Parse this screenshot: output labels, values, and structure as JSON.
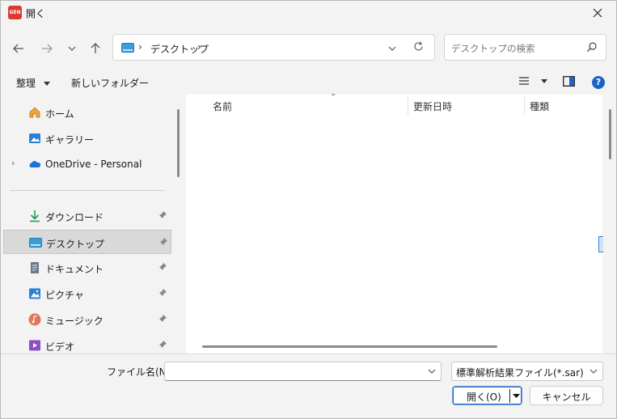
{
  "window": {
    "title": "開く",
    "app_icon_text": "GEN"
  },
  "nav": {
    "address_segments": [
      "デスクトップ"
    ],
    "search_placeholder": "デスクトップの検索"
  },
  "toolbar": {
    "organize_label": "整理",
    "new_folder_label": "新しいフォルダー",
    "help_label": "?"
  },
  "sidebar": {
    "items": [
      {
        "label": "ホーム",
        "icon": "home-icon"
      },
      {
        "label": "ギャラリー",
        "icon": "gallery-icon"
      },
      {
        "label": "OneDrive - Personal",
        "icon": "onedrive-icon"
      },
      {
        "label": "ダウンロード",
        "icon": "download-icon",
        "pinned": true
      },
      {
        "label": "デスクトップ",
        "icon": "desktop-icon",
        "pinned": true,
        "selected": true
      },
      {
        "label": "ドキュメント",
        "icon": "document-icon",
        "pinned": true
      },
      {
        "label": "ピクチャ",
        "icon": "pictures-icon",
        "pinned": true
      },
      {
        "label": "ミュージック",
        "icon": "music-icon",
        "pinned": true
      },
      {
        "label": "ビデオ",
        "icon": "video-icon",
        "pinned": true
      }
    ]
  },
  "content": {
    "columns": [
      "名前",
      "更新日時",
      "種類"
    ]
  },
  "footer": {
    "filename_label": "ファイル名(N):",
    "filename_value": "",
    "filter_value": "標準解析結果ファイル(*.sar)",
    "open_label": "開く(O)",
    "cancel_label": "キャンセル"
  },
  "colors": {
    "accent": "#2867c5",
    "selected_bg": "#d9d9d9",
    "app_icon": "#d83b32"
  }
}
